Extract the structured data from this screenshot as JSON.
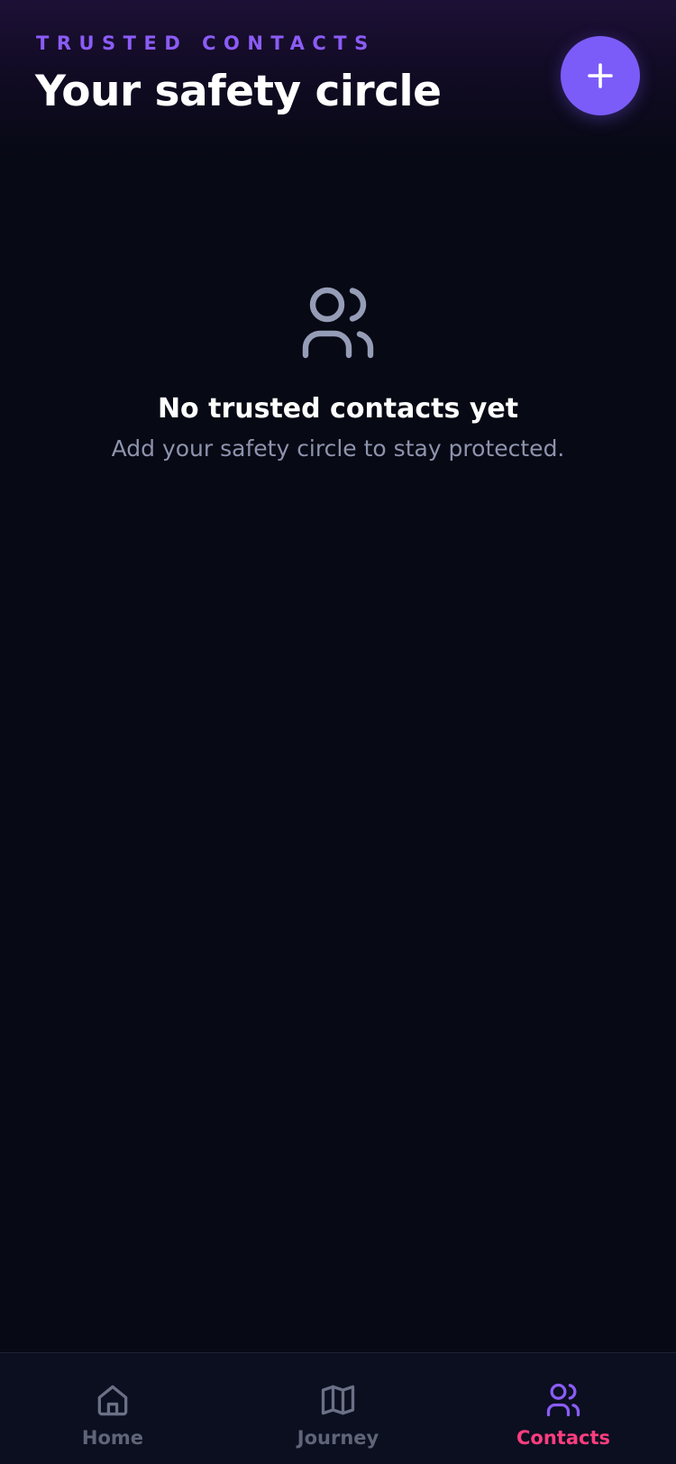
{
  "header": {
    "overline": "TRUSTED CONTACTS",
    "title": "Your safety circle",
    "add_button_icon": "plus-icon"
  },
  "empty_state": {
    "icon": "users-icon",
    "title": "No trusted contacts yet",
    "subtitle": "Add your safety circle to stay protected."
  },
  "tabbar": {
    "active": "Contacts",
    "items": [
      {
        "label": "Home",
        "icon": "home-icon"
      },
      {
        "label": "Journey",
        "icon": "map-icon"
      },
      {
        "label": "Contacts",
        "icon": "users-icon"
      }
    ]
  },
  "colors": {
    "background": "#070914",
    "accent": "#7c5cf8",
    "overline": "#8b5cf6",
    "active_tab": "#ff3d7f",
    "inactive_tab": "#5f6478",
    "muted_text": "#8e93ad"
  }
}
